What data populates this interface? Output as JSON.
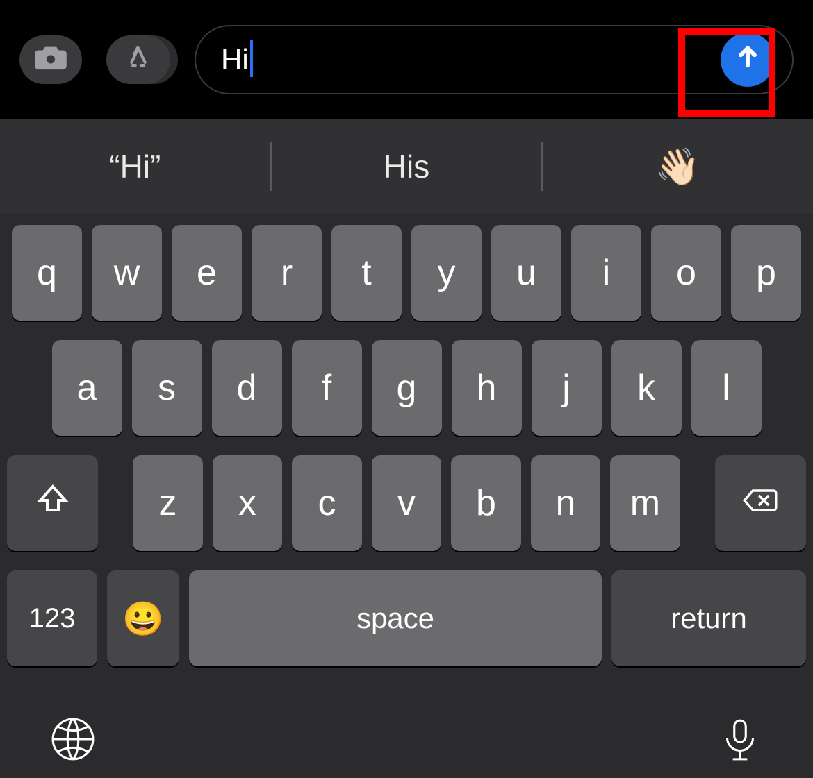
{
  "colors": {
    "send_button": "#1e73e8",
    "highlight_box": "#ff0000",
    "key_light": "#6b6b6e",
    "key_dark": "#464649",
    "caret": "#2e6df6"
  },
  "compose": {
    "text": "Hi"
  },
  "suggestions": {
    "s1": "“Hi”",
    "s2": "His",
    "s3": "👋🏻"
  },
  "keyboard": {
    "row1": {
      "k0": "q",
      "k1": "w",
      "k2": "e",
      "k3": "r",
      "k4": "t",
      "k5": "y",
      "k6": "u",
      "k7": "i",
      "k8": "o",
      "k9": "p"
    },
    "row2": {
      "k0": "a",
      "k1": "s",
      "k2": "d",
      "k3": "f",
      "k4": "g",
      "k5": "h",
      "k6": "j",
      "k7": "k",
      "k8": "l"
    },
    "row3": {
      "k0": "z",
      "k1": "x",
      "k2": "c",
      "k3": "v",
      "k4": "b",
      "k5": "n",
      "k6": "m"
    },
    "numeric_label": "123",
    "emoji_label": "😀",
    "space_label": "space",
    "return_label": "return"
  }
}
